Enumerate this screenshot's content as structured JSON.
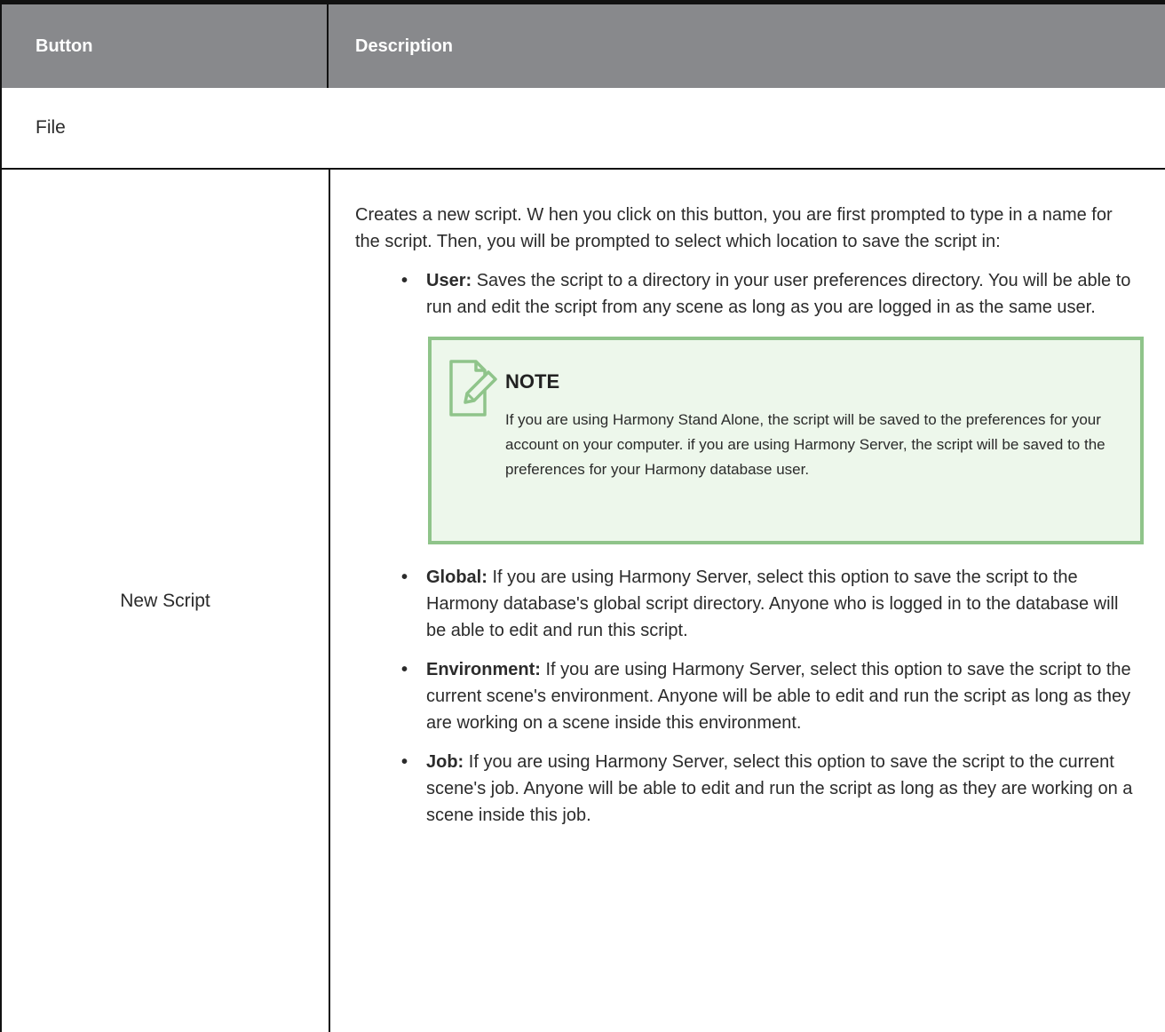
{
  "table": {
    "headers": {
      "col1": "Button",
      "col2": "Description"
    },
    "section": "File",
    "row": {
      "button_name": "New Script",
      "intro": "Creates a new script. W hen you click on this button, you are first prompted to type in a name for the script. Then, you will be prompted to select which location to save the script in:",
      "options": [
        {
          "term": "User:",
          "text": " Saves the script to a directory in your user preferences directory. You will be able to run and edit the script from any scene as long as you are logged in as the same user."
        },
        {
          "term": "Global:",
          "text": " If you are using Harmony Server, select this option to save the script to the Harmony database's global script directory. Anyone who is logged in to the database will be able to edit and run this script."
        },
        {
          "term": "Environment:",
          "text": " If you are using Harmony Server, select this option to save the script to the current scene's environment. Anyone will be able to edit and run the script as long as they are working on a scene inside this environment."
        },
        {
          "term": "Job:",
          "text": " If you are using Harmony Server, select this option to save the script to the current scene's job. Anyone will be able to edit and run the script as long as they are working on a scene inside this job."
        }
      ],
      "note": {
        "title": "NOTE",
        "text": "If you are using Harmony Stand Alone, the script will be saved to the preferences for your account on your computer. if you are using Harmony Server, the script will be saved to the preferences for your Harmony database user.",
        "icon": "note-edit-icon"
      }
    }
  },
  "colors": {
    "header_bg": "#88898c",
    "note_bg": "#edf7eb",
    "note_border": "#8fc48a"
  }
}
